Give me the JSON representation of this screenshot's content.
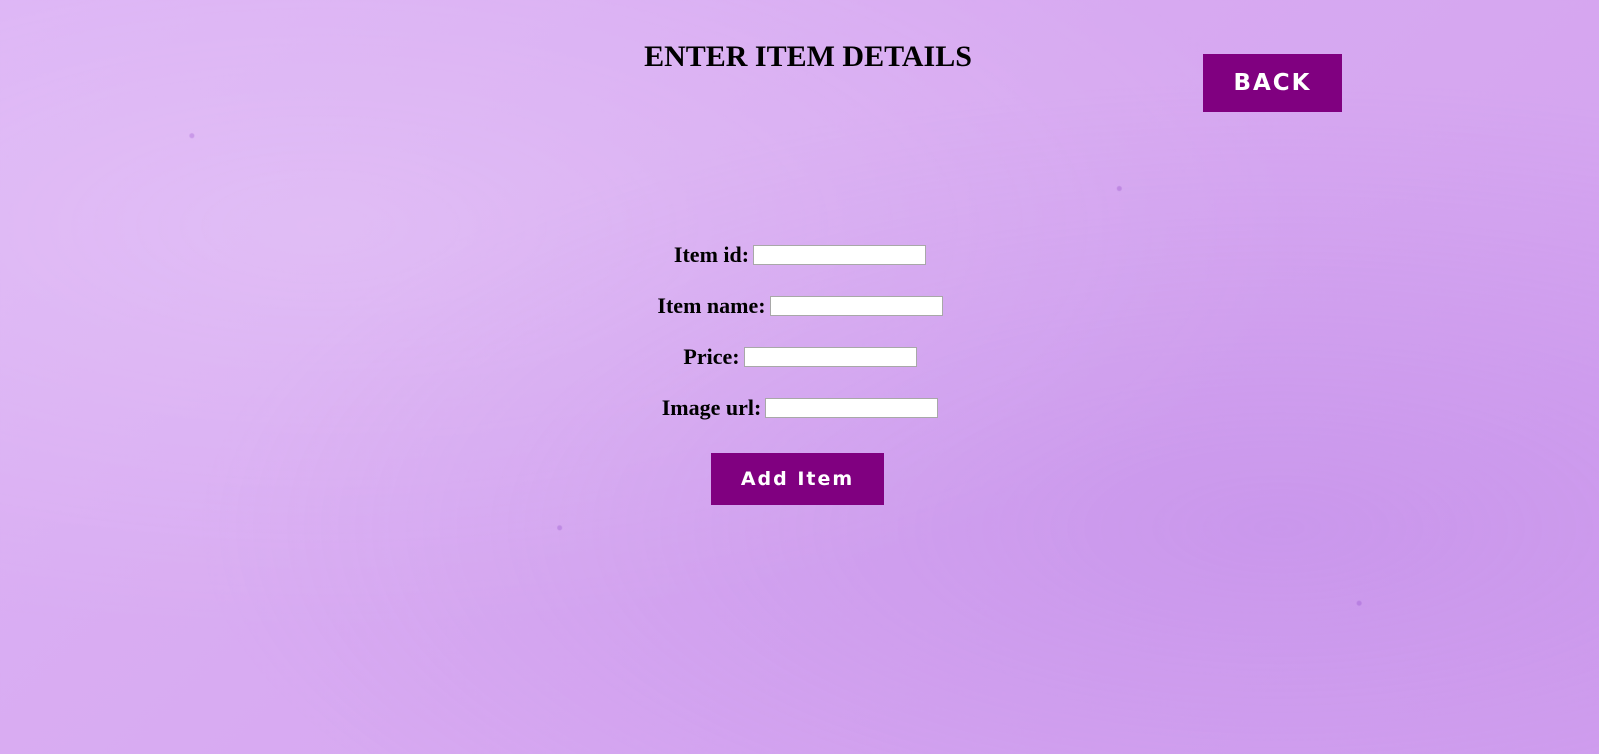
{
  "header": {
    "title": "ENTER ITEM DETAILS",
    "back_label": "BACK"
  },
  "form": {
    "fields": [
      {
        "label": "Item id:",
        "value": "",
        "placeholder": ""
      },
      {
        "label": "Item name:",
        "value": "",
        "placeholder": ""
      },
      {
        "label": "Price:",
        "value": "",
        "placeholder": ""
      },
      {
        "label": "Image url:",
        "value": "",
        "placeholder": ""
      }
    ],
    "submit_label": "Add Item"
  },
  "colors": {
    "background": "#d9acf3",
    "button": "#800080",
    "button_text": "#ffffff"
  }
}
